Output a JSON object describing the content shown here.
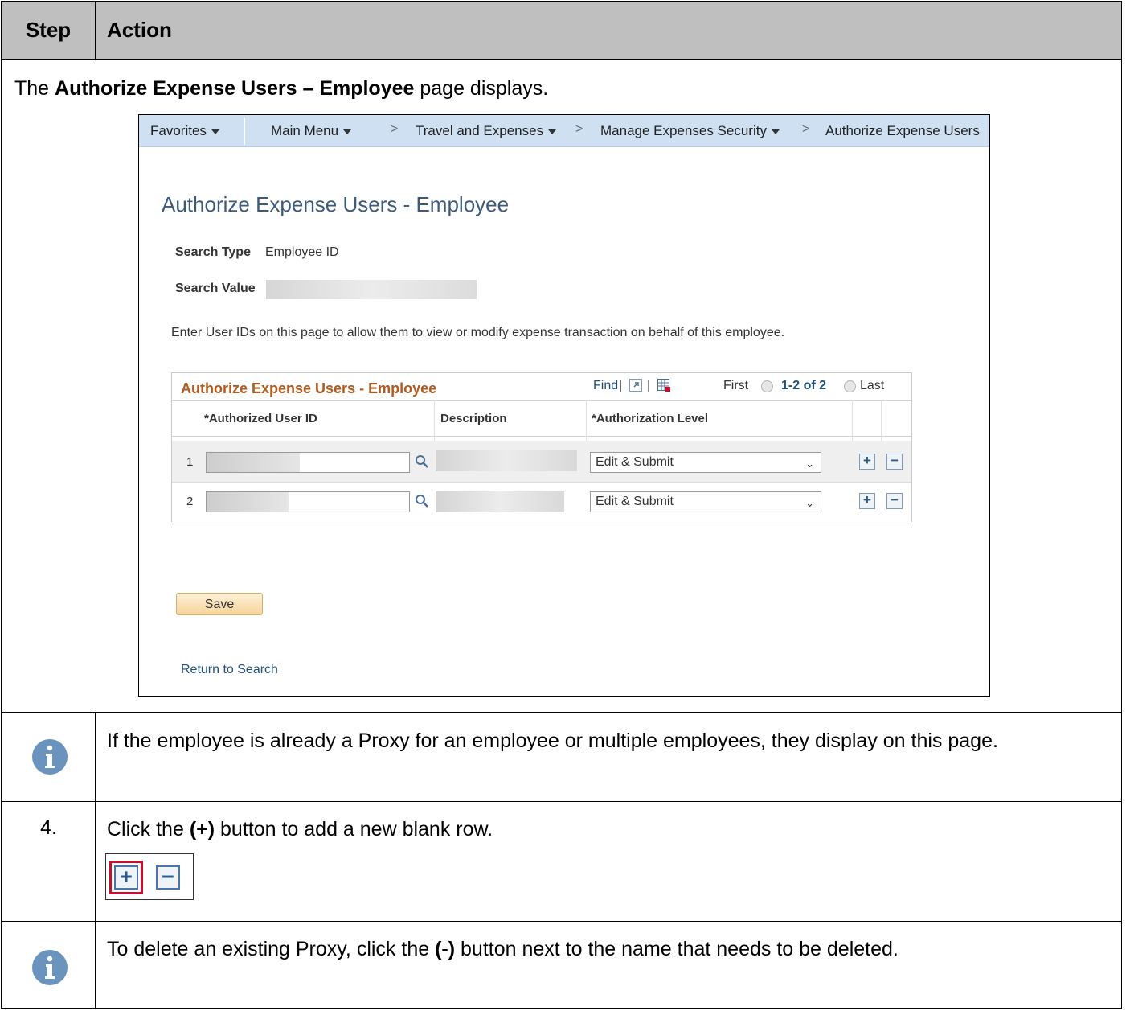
{
  "header": {
    "step": "Step",
    "action": "Action"
  },
  "intro": {
    "prefix": "The ",
    "bold": "Authorize Expense Users – Employee",
    "suffix": " page displays."
  },
  "screenshot": {
    "nav": {
      "favorites": "Favorites",
      "main_menu": "Main Menu",
      "travel": "Travel and Expenses",
      "security": "Manage Expenses Security",
      "authorize": "Authorize Expense Users"
    },
    "page_title": "Authorize Expense Users - Employee",
    "search_type_label": "Search Type",
    "search_type_value": "Employee ID",
    "search_value_label": "Search Value",
    "instructions": "Enter User IDs on this page to allow them to view or modify expense transaction on behalf of this employee.",
    "grid": {
      "title": "Authorize Expense Users - Employee",
      "find": "Find",
      "first": "First",
      "range": "1-2 of 2",
      "last": "Last",
      "columns": [
        "*Authorized User ID",
        "Description",
        "*Authorization Level"
      ],
      "rows": [
        {
          "num": "1",
          "level": "Edit & Submit"
        },
        {
          "num": "2",
          "level": "Edit & Submit"
        }
      ]
    },
    "save": "Save",
    "return": "Return to Search"
  },
  "notes": [
    {
      "type": "info",
      "text": "If the employee is already a Proxy for an employee or multiple employees, they display on this page."
    },
    {
      "type": "step",
      "num": "4.",
      "prefix": "Click the ",
      "bold": "(+)",
      "suffix": " button to add a new blank row."
    },
    {
      "type": "info",
      "prefix": "To delete an existing Proxy, click the ",
      "bold": "(-)",
      "suffix": " button next to the name that needs to be deleted."
    }
  ],
  "colors": {
    "header_bg": "#bfbfbf",
    "nav_bg": "#cfe0f3",
    "title_blue": "#3c5a7a",
    "grid_title_orange": "#b45a1e",
    "highlight_red": "#c8102e",
    "info_icon": "#6a93be"
  },
  "icons": [
    "info-icon",
    "lookup-icon",
    "plus-icon",
    "minus-icon",
    "zoom-icon",
    "download-icon",
    "first-arrow-icon",
    "next-arrow-icon"
  ]
}
